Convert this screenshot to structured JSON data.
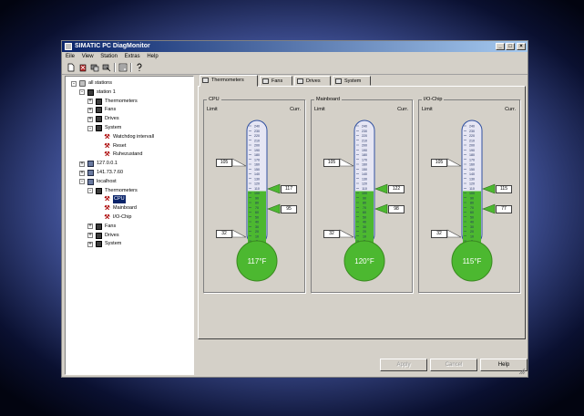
{
  "window": {
    "title": "SIMATIC PC DiagMonitor",
    "min": "_",
    "max": "□",
    "close": "×"
  },
  "menu": [
    "Eile",
    "View",
    "Station",
    "Extras",
    "Help"
  ],
  "toolbar": [
    "new-icon",
    "delete-icon",
    "connect-icon",
    "disconnect-icon",
    "properties-icon",
    "help-icon"
  ],
  "tree": [
    {
      "label": "all stations",
      "level": 0,
      "icon": "world",
      "expander": "-"
    },
    {
      "label": "station 1",
      "level": 1,
      "icon": "folder",
      "expander": "-"
    },
    {
      "label": "Thermometers",
      "level": 2,
      "icon": "folder",
      "expander": "+"
    },
    {
      "label": "Fans",
      "level": 2,
      "icon": "folder",
      "expander": "+"
    },
    {
      "label": "Drives",
      "level": 2,
      "icon": "folder",
      "expander": "+"
    },
    {
      "label": "System",
      "level": 2,
      "icon": "folder",
      "expander": "-"
    },
    {
      "label": "Watchdog intervall",
      "level": 3,
      "icon": "tool"
    },
    {
      "label": "Reset",
      "level": 3,
      "icon": "tool"
    },
    {
      "label": "Ruhezustand",
      "level": 3,
      "icon": "tool"
    },
    {
      "label": "127.0.0.1",
      "level": 1,
      "icon": "pc",
      "expander": "+"
    },
    {
      "label": "141.73.7.60",
      "level": 1,
      "icon": "pc",
      "expander": "+"
    },
    {
      "label": "localhost",
      "level": 1,
      "icon": "pc",
      "expander": "-"
    },
    {
      "label": "Thermometers",
      "level": 2,
      "icon": "folder",
      "expander": "-"
    },
    {
      "label": "CPU",
      "level": 3,
      "icon": "tool",
      "selected": true
    },
    {
      "label": "Mainboard",
      "level": 3,
      "icon": "tool"
    },
    {
      "label": "I/O-Chip",
      "level": 3,
      "icon": "tool"
    },
    {
      "label": "Fans",
      "level": 2,
      "icon": "folder",
      "expander": "+"
    },
    {
      "label": "Drives",
      "level": 2,
      "icon": "folder",
      "expander": "+"
    },
    {
      "label": "System",
      "level": 2,
      "icon": "folder",
      "expander": "+"
    }
  ],
  "tabs": [
    "Thermometers",
    "Fans",
    "Drives",
    "System"
  ],
  "thermometers": [
    {
      "name": "CPU",
      "limit_label": "Limit",
      "curr_label": "Curr.",
      "limit_high": "105",
      "limit_low": "32",
      "current": "117",
      "min_val": "95",
      "bulb": "117°F",
      "fill": 0.43
    },
    {
      "name": "Mainboard",
      "limit_label": "Limit",
      "curr_label": "Curr.",
      "limit_high": "105",
      "limit_low": "32",
      "current": "122",
      "min_val": "98",
      "bulb": "120°F",
      "fill": 0.43
    },
    {
      "name": "I/O-Chip",
      "limit_label": "Limit",
      "curr_label": "Curr.",
      "limit_high": "105",
      "limit_low": "32",
      "current": "115",
      "min_val": "77",
      "bulb": "115°F",
      "fill": 0.43
    }
  ],
  "scale": [
    "240",
    "230",
    "220",
    "210",
    "200",
    "190",
    "180",
    "170",
    "160",
    "150",
    "140",
    "130",
    "120",
    "110",
    "100",
    "90",
    "80",
    "70",
    "60",
    "50",
    "40",
    "30",
    "20",
    "10",
    "0"
  ],
  "buttons": {
    "apply": "Apply",
    "cancel": "Cancel",
    "help": "Help"
  },
  "colors": {
    "fill": "#4cb830",
    "tube": "#e6e6f4",
    "outline": "#3050a0",
    "selection": "#0a246a"
  }
}
